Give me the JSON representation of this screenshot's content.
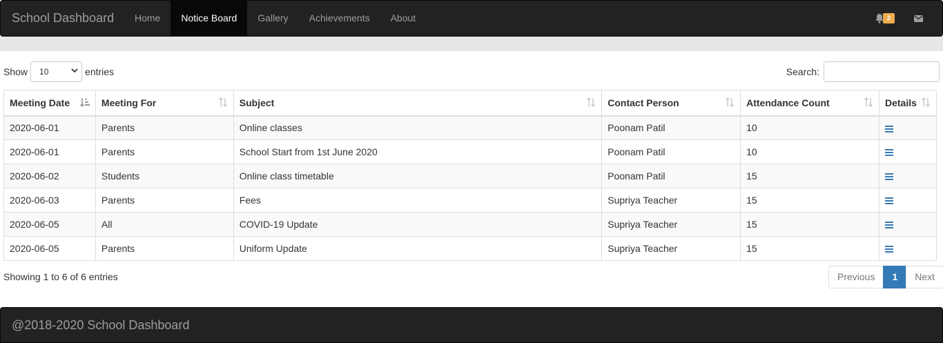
{
  "navbar": {
    "brand": "School Dashboard",
    "items": [
      {
        "label": "Home",
        "active": false
      },
      {
        "label": "Notice Board",
        "active": true
      },
      {
        "label": "Gallery",
        "active": false
      },
      {
        "label": "Achievements",
        "active": false
      },
      {
        "label": "About",
        "active": false
      }
    ],
    "notification_count": "2",
    "icons": [
      "bell-icon",
      "envelope-icon"
    ]
  },
  "controls": {
    "show_label": "Show",
    "entries_value": "10",
    "entries_label": "entries",
    "search_label": "Search:",
    "search_value": ""
  },
  "table": {
    "headers": [
      "Meeting Date",
      "Meeting For",
      "Subject",
      "Contact Person",
      "Attendance Count",
      "Details"
    ],
    "rows": [
      [
        "2020-06-01",
        "Parents",
        "Online classes",
        "Poonam Patil",
        "10"
      ],
      [
        "2020-06-01",
        "Parents",
        "School Start from 1st June 2020",
        "Poonam Patil",
        "10"
      ],
      [
        "2020-06-02",
        "Students",
        "Online class timetable",
        "Poonam Patil",
        "15"
      ],
      [
        "2020-06-03",
        "Parents",
        "Fees",
        "Supriya Teacher",
        "15"
      ],
      [
        "2020-06-05",
        "All",
        "COVID-19 Update",
        "Supriya Teacher",
        "15"
      ],
      [
        "2020-06-05",
        "Parents",
        "Uniform Update",
        "Supriya Teacher",
        "15"
      ]
    ],
    "details_icon": "menu-lines-icon"
  },
  "footer_info": {
    "showing": "Showing 1 to 6 of 6 entries"
  },
  "pagination": {
    "previous": "Previous",
    "current": "1",
    "next": "Next"
  },
  "footer": {
    "text": "@2018-2020 School Dashboard"
  },
  "colors": {
    "navbar_bg": "#222222",
    "accent": "#337ab7",
    "badge": "#f0ad4e"
  }
}
